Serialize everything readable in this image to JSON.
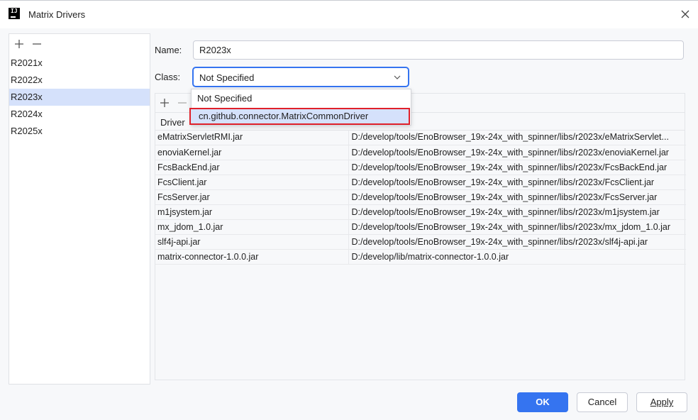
{
  "window": {
    "title": "Matrix Drivers"
  },
  "left_panel": {
    "versions": [
      "R2021x",
      "R2022x",
      "R2023x",
      "R2024x",
      "R2025x"
    ],
    "selected": "R2023x"
  },
  "form": {
    "name_label": "Name:",
    "name_value": "R2023x",
    "class_label": "Class:",
    "class_value": "Not Specified"
  },
  "dropdown": {
    "options": [
      "Not Specified",
      "cn.github.connector.MatrixCommonDriver"
    ]
  },
  "driver_table": {
    "header_col1": "Driver",
    "rows": [
      {
        "file": "eMatrixServletRMI.jar",
        "path": "D:/develop/tools/EnoBrowser_19x-24x_with_spinner/libs/r2023x/eMatrixServlet..."
      },
      {
        "file": "enoviaKernel.jar",
        "path": "D:/develop/tools/EnoBrowser_19x-24x_with_spinner/libs/r2023x/enoviaKernel.jar"
      },
      {
        "file": "FcsBackEnd.jar",
        "path": "D:/develop/tools/EnoBrowser_19x-24x_with_spinner/libs/r2023x/FcsBackEnd.jar"
      },
      {
        "file": "FcsClient.jar",
        "path": "D:/develop/tools/EnoBrowser_19x-24x_with_spinner/libs/r2023x/FcsClient.jar"
      },
      {
        "file": "FcsServer.jar",
        "path": "D:/develop/tools/EnoBrowser_19x-24x_with_spinner/libs/r2023x/FcsServer.jar"
      },
      {
        "file": "m1jsystem.jar",
        "path": "D:/develop/tools/EnoBrowser_19x-24x_with_spinner/libs/r2023x/m1jsystem.jar"
      },
      {
        "file": "mx_jdom_1.0.jar",
        "path": "D:/develop/tools/EnoBrowser_19x-24x_with_spinner/libs/r2023x/mx_jdom_1.0.jar"
      },
      {
        "file": "slf4j-api.jar",
        "path": "D:/develop/tools/EnoBrowser_19x-24x_with_spinner/libs/r2023x/slf4j-api.jar"
      },
      {
        "file": "matrix-connector-1.0.0.jar",
        "path": "D:/develop/lib/matrix-connector-1.0.0.jar"
      }
    ]
  },
  "buttons": {
    "ok": "OK",
    "cancel": "Cancel",
    "apply": "Apply"
  },
  "colors": {
    "accent": "#3574f0",
    "selection": "#d5e1fb",
    "highlight_border": "#e0202a"
  },
  "icons": {
    "logo": "intellij-logo-icon",
    "close": "close-icon",
    "add": "plus-icon",
    "remove": "minus-icon",
    "dropdown": "chevron-down-icon"
  }
}
